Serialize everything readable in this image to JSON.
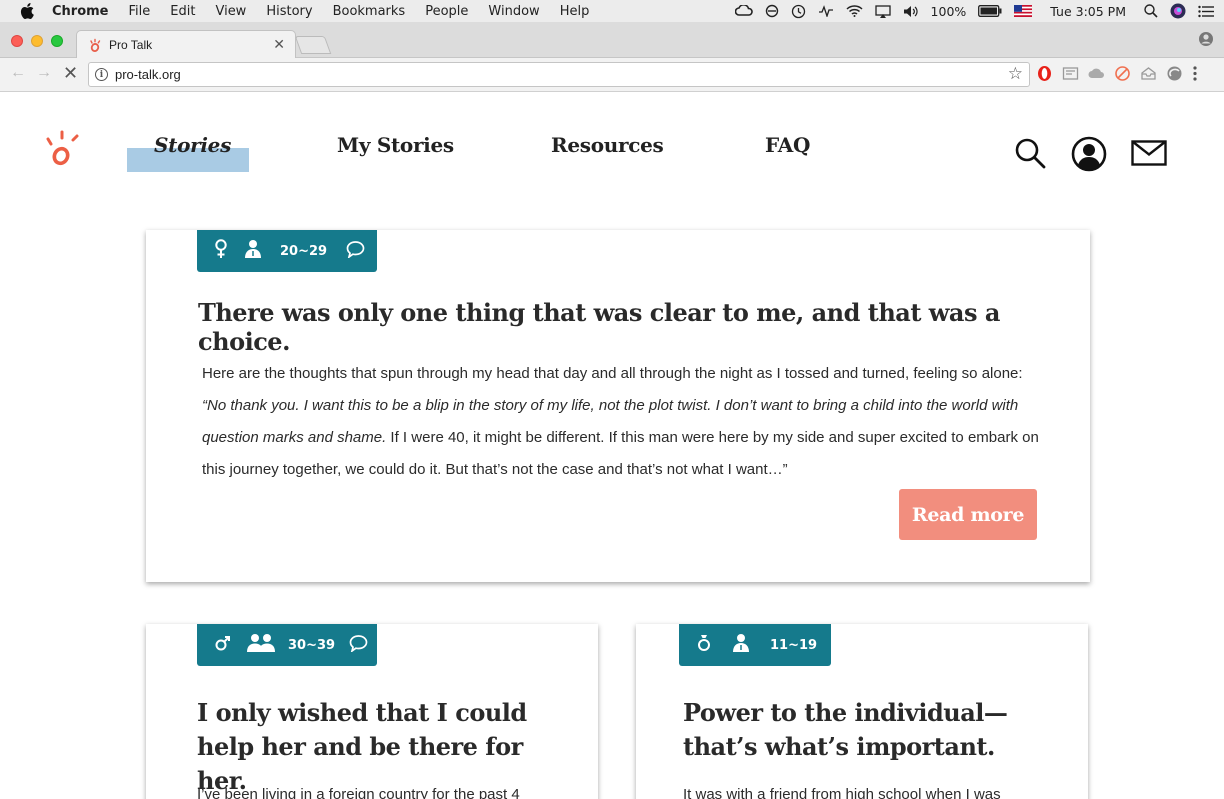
{
  "menubar": {
    "app_name": "Chrome",
    "items": [
      "File",
      "Edit",
      "View",
      "History",
      "Bookmarks",
      "People",
      "Window",
      "Help"
    ],
    "battery": "100%",
    "clock": "Tue 3:05 PM"
  },
  "browser": {
    "tab_title": "Pro Talk",
    "tab_close": "✕",
    "url": "pro-talk.org"
  },
  "site": {
    "nav": {
      "stories": "Stories",
      "my_stories": "My Stories",
      "resources": "Resources",
      "faq": "FAQ"
    },
    "accent_color": "#157a8c",
    "button_color": "#f28e7e",
    "highlight_color": "#a9cbe4"
  },
  "stories": [
    {
      "gender_icon": "female-icon",
      "person_icon": "person-icon",
      "age": "20~29",
      "has_comment_icon": true,
      "title": "There was only one thing that was clear to me, and that was a choice.",
      "excerpt_intro": "Here are the thoughts that spun through my head that day and all through the night as I tossed and turned, feeling so alone: ",
      "excerpt_quote": "“No thank you. I want this to be a blip in the story of my life, not the plot twist. I don’t want to bring a child into the world with question marks and shame.",
      "excerpt_rest": " If I were 40, it might be different. If this man were here by my side and super excited to embark on this journey together, we could do it. But that’s not the case and that’s not what I want…”",
      "read_more": "Read more"
    },
    {
      "gender_icon": "male-icon",
      "person_icon": "two-people-icon",
      "age": "30~39",
      "has_comment_icon": true,
      "title": "I only wished that I could help her and be there for her.",
      "excerpt": "I’ve been living in a foreign country for the past 4"
    },
    {
      "gender_icon": "ring-icon",
      "person_icon": "person-icon",
      "age": "11~19",
      "has_comment_icon": false,
      "title": "Power to the individual— that’s what’s important.",
      "excerpt": "It was with a friend from high school when I was"
    }
  ]
}
